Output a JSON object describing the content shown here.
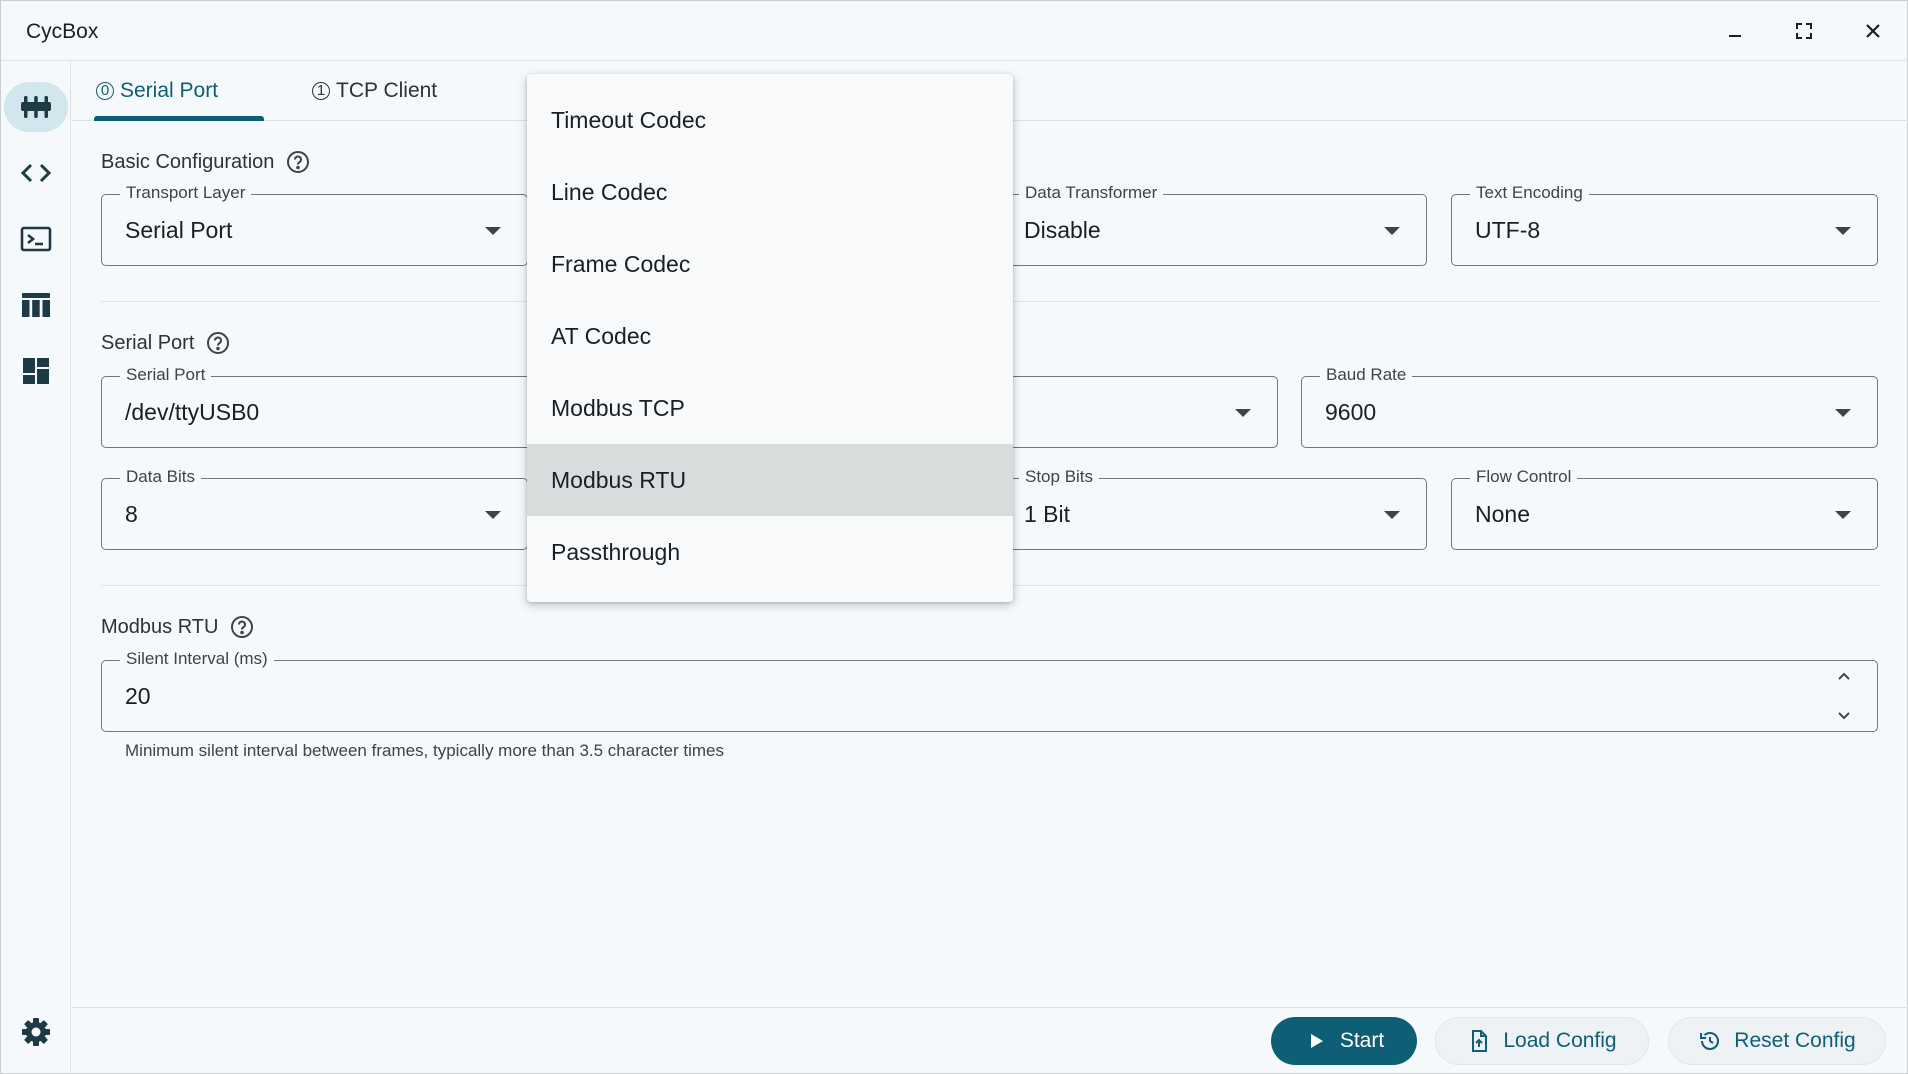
{
  "window": {
    "title": "CycBox"
  },
  "window_controls": [
    "minimize-icon",
    "maximize-icon",
    "close-icon"
  ],
  "rail": {
    "items": [
      "connection-icon",
      "code-icon",
      "terminal-icon",
      "table-icon",
      "dashboard-icon"
    ],
    "bottom": "gear-icon"
  },
  "tabs": [
    {
      "label": "Serial Port",
      "indicator": "0",
      "active": true
    },
    {
      "label": "TCP Client",
      "indicator": "1",
      "active": false
    }
  ],
  "basic": {
    "title": "Basic Configuration",
    "transport_label": "Transport Layer",
    "transport_value": "Serial Port",
    "transformer_label": "Data Transformer",
    "transformer_value": "Disable",
    "encoding_label": "Text Encoding",
    "encoding_value": "UTF-8"
  },
  "serial": {
    "title": "Serial Port",
    "port_label": "Serial Port",
    "port_value": "/dev/ttyUSB0",
    "baud_label": "Baud Rate",
    "baud_value": "9600",
    "databits_label": "Data Bits",
    "databits_value": "8",
    "stopbits_label": "Stop Bits",
    "stopbits_value": "1 Bit",
    "flow_label": "Flow Control",
    "flow_value": "None"
  },
  "modbus": {
    "title": "Modbus RTU",
    "silent_label": "Silent Interval (ms)",
    "silent_value": "20",
    "helper": "Minimum silent interval between frames, typically more than 3.5 character times"
  },
  "codec_menu": {
    "items": [
      "Timeout Codec",
      "Line Codec",
      "Frame Codec",
      "AT Codec",
      "Modbus TCP",
      "Modbus RTU",
      "Passthrough"
    ],
    "selected": "Modbus RTU"
  },
  "actions": {
    "start": "Start",
    "load": "Load Config",
    "reset": "Reset Config"
  },
  "colors": {
    "accent": "#0e5f75",
    "rail_active": "#d2e6ee",
    "menu_selected": "#d8dcdd",
    "background": "#f5f9fb"
  }
}
